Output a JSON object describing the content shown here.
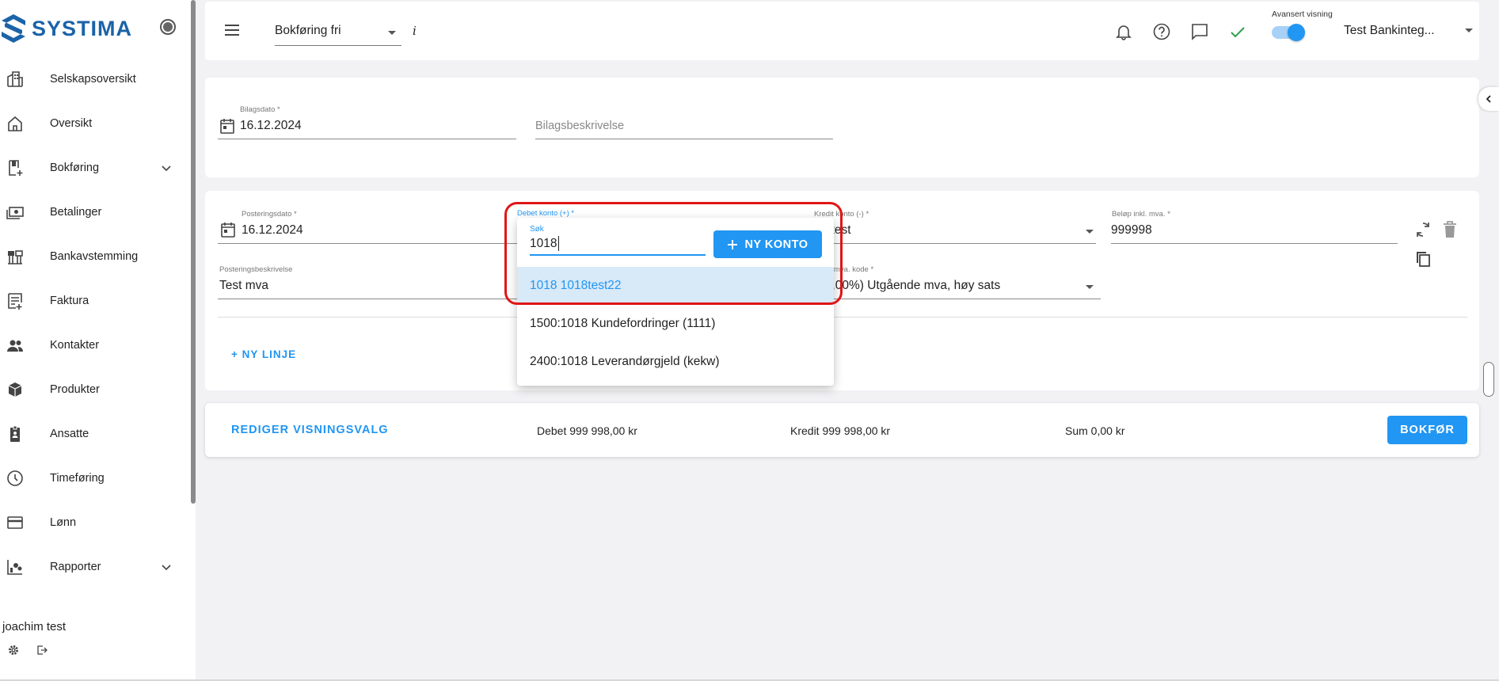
{
  "brand": {
    "name": "SYSTIMA",
    "color": "#1b63a8",
    "accent": "#2196f3"
  },
  "sidebar": {
    "items": [
      {
        "label": "Selskapsoversikt",
        "icon": "company-overview-icon"
      },
      {
        "label": "Oversikt",
        "icon": "home-icon"
      },
      {
        "label": "Bokføring",
        "icon": "bookkeeping-icon",
        "expandable": true
      },
      {
        "label": "Betalinger",
        "icon": "payments-icon"
      },
      {
        "label": "Bankavstemming",
        "icon": "bank-reconciliation-icon"
      },
      {
        "label": "Faktura",
        "icon": "invoice-icon"
      },
      {
        "label": "Kontakter",
        "icon": "contacts-icon"
      },
      {
        "label": "Produkter",
        "icon": "products-icon"
      },
      {
        "label": "Ansatte",
        "icon": "employees-icon"
      },
      {
        "label": "Timeføring",
        "icon": "clock-icon"
      },
      {
        "label": "Lønn",
        "icon": "payroll-icon"
      },
      {
        "label": "Rapporter",
        "icon": "reports-icon",
        "expandable": true
      }
    ],
    "user": {
      "name": "joachim test"
    }
  },
  "topbar": {
    "period_select": "Bokføring fri",
    "info": "i",
    "advanced_label": "Avansert visning",
    "advanced_on": true,
    "company": "Test Bankinteg..."
  },
  "voucher": {
    "date_label": "Bilagsdato *",
    "date_value": "16.12.2024",
    "description_placeholder": "Bilagsbeskrivelse"
  },
  "posting": {
    "date_label": "Posteringsdato *",
    "date_value": "16.12.2024",
    "debit_label": "Debet konto (+) *",
    "credit_label": "Kredit konto (-) *",
    "credit_value": "99 test",
    "amount_label": "Beløp inkl. mva. *",
    "amount_value": "999998",
    "description_label": "Posteringsbeskrivelse",
    "description_value": "Test mva",
    "vat_label": "mva. kode *",
    "vat_value": "(25,00%) Utgående mva, høy sats",
    "add_line": "+ NY LINJE"
  },
  "footer": {
    "edit_view": "REDIGER VISNINGSVALG",
    "debit": "Debet 999 998,00 kr",
    "credit": "Kredit 999 998,00 kr",
    "sum": "Sum 0,00 kr",
    "book_button": "BOKFØR"
  },
  "dropdown": {
    "search_label": "Søk",
    "search_value": "1018",
    "new_account_button": "NY KONTO",
    "options": [
      "1018 1018test22",
      "1500:1018 Kundefordringer (1111)",
      "2400:1018 Leverandørgjeld (kekw)"
    ],
    "highlight_color": "#e01616"
  }
}
